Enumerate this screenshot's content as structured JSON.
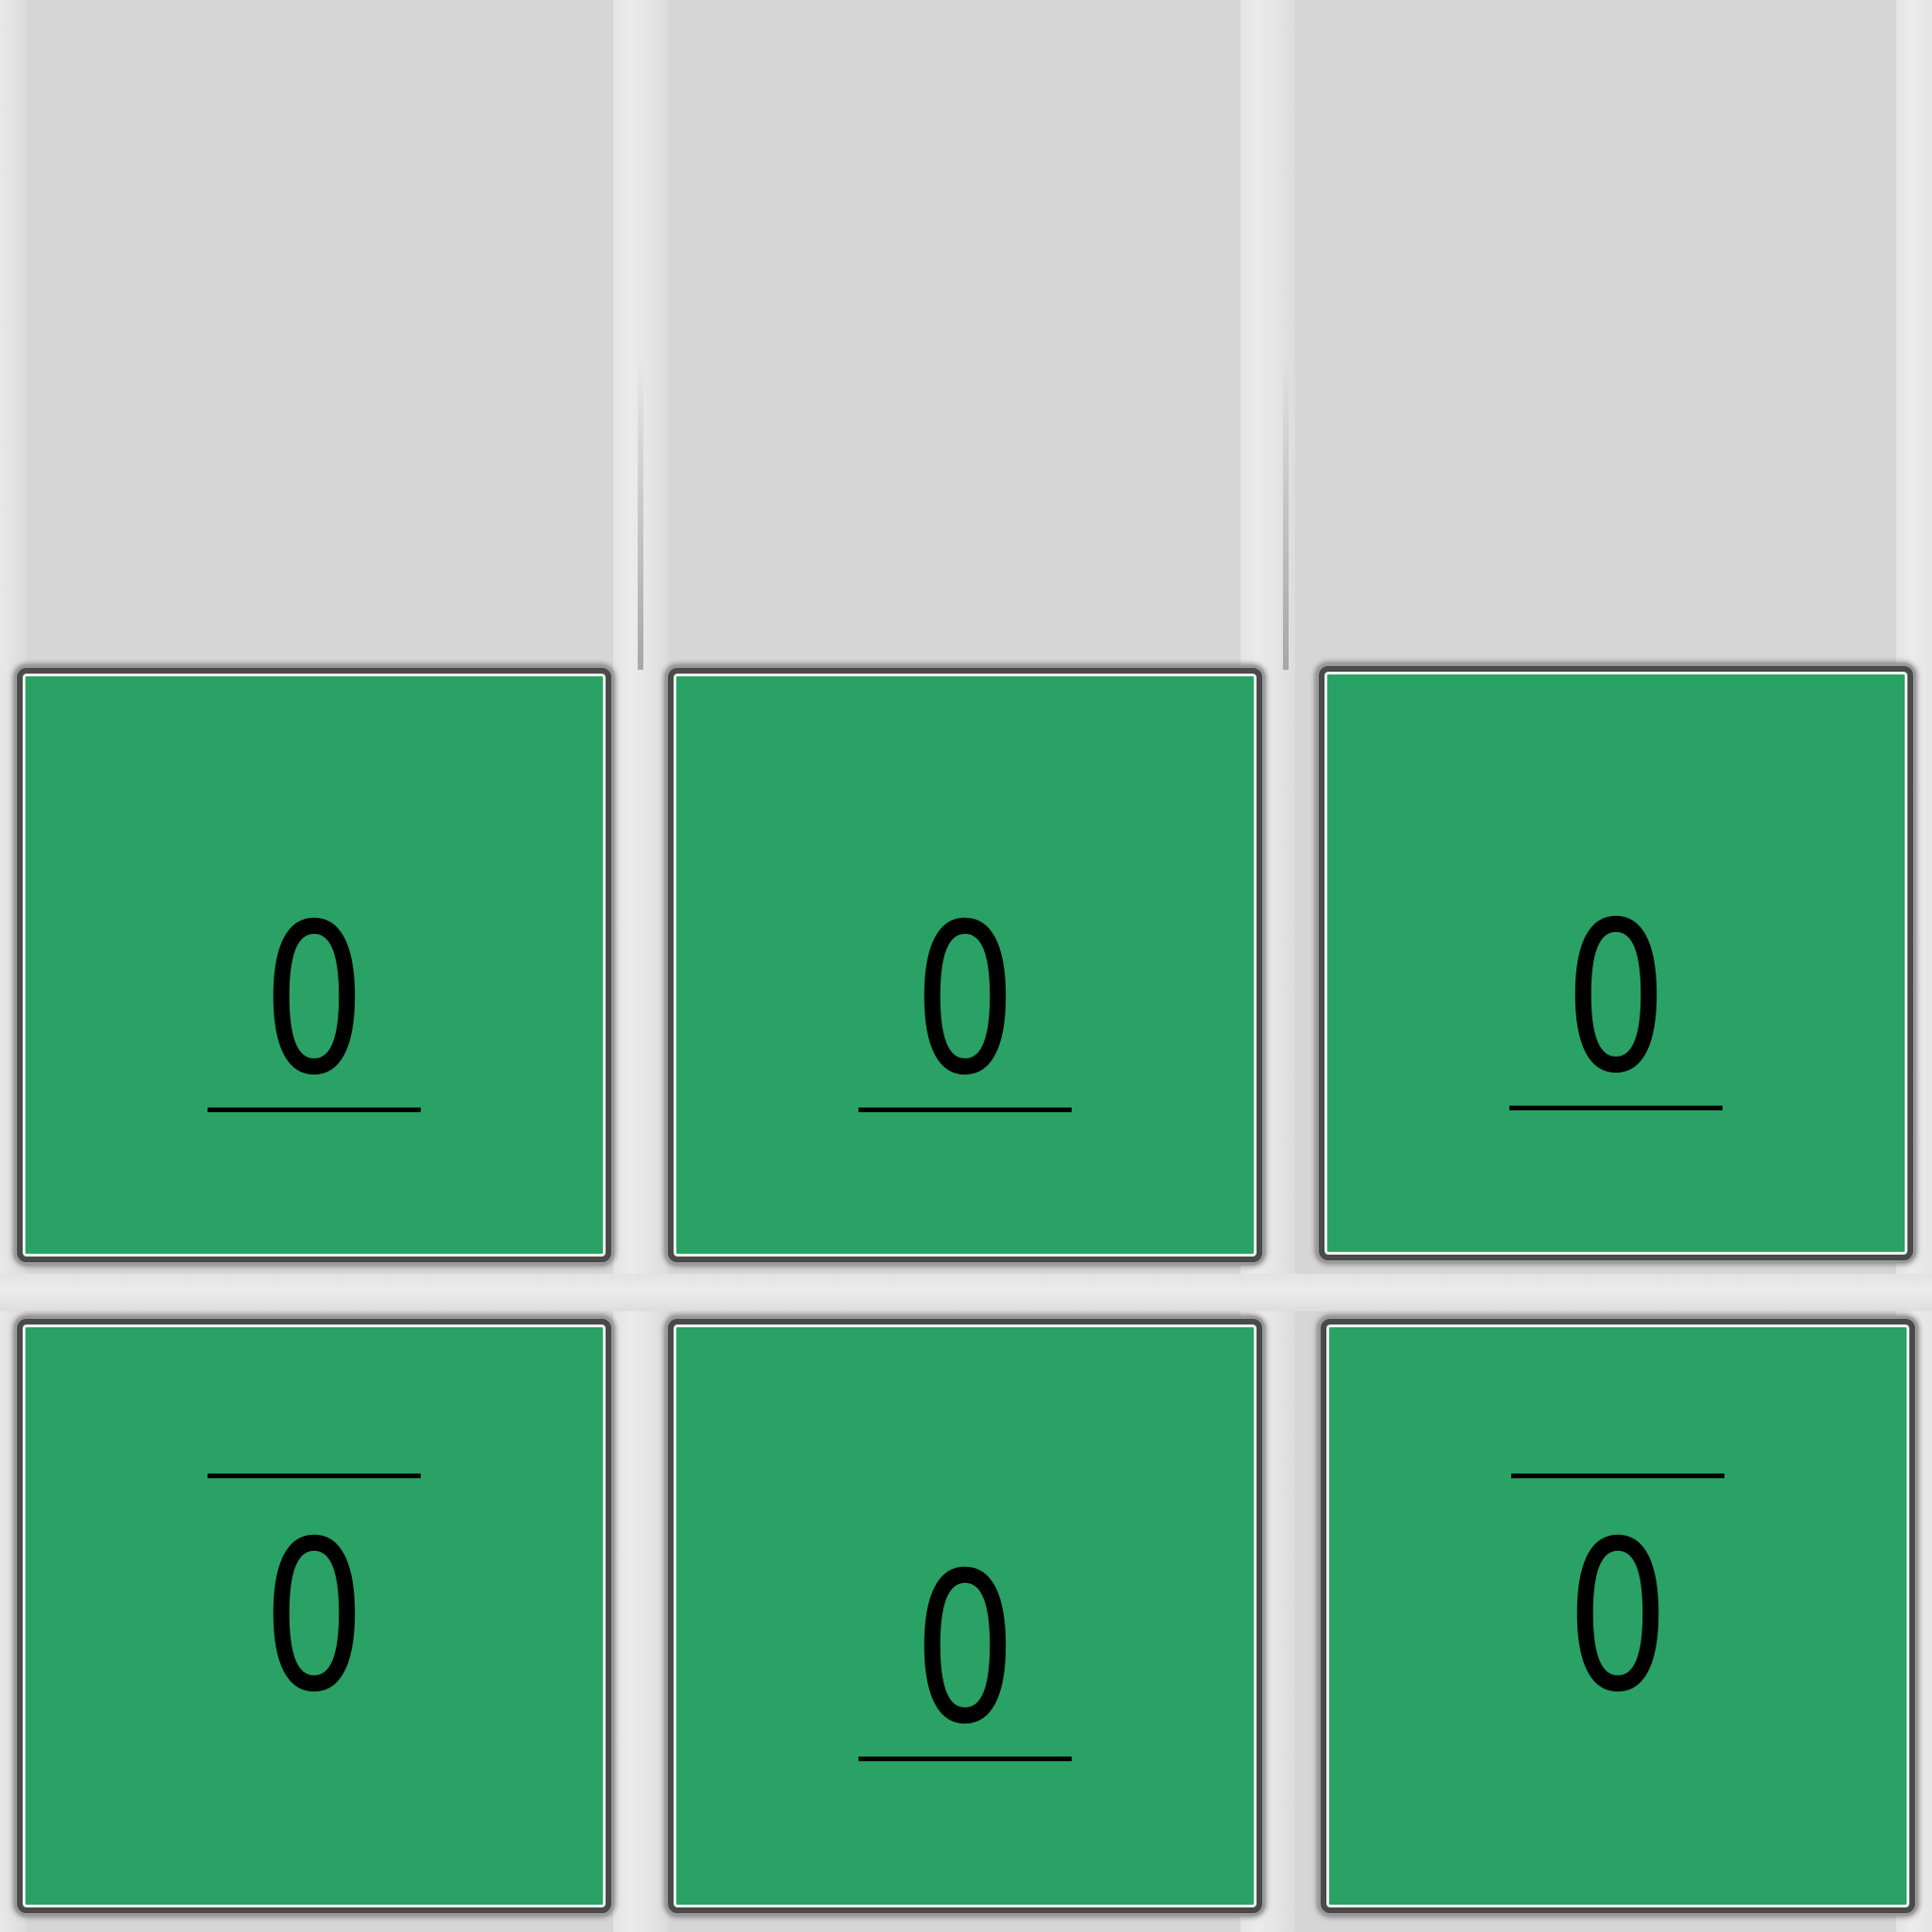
{
  "board": {
    "background_color": "#d6d6d6",
    "tile_color": "#2aa165",
    "empty_slots": 3,
    "tiles": [
      {
        "value": "0",
        "line": "below"
      },
      {
        "value": "0",
        "line": "below"
      },
      {
        "value": "0",
        "line": "below"
      },
      {
        "value": "0",
        "line": "above"
      },
      {
        "value": "0",
        "line": "below"
      },
      {
        "value": "0",
        "line": "above"
      }
    ]
  }
}
